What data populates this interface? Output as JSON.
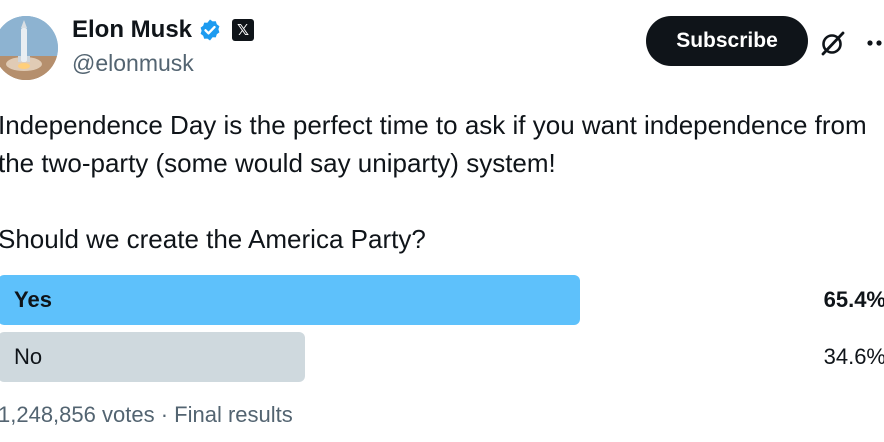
{
  "author": {
    "name": "Elon Musk",
    "handle": "@elonmusk",
    "x_badge": "𝕏"
  },
  "header": {
    "subscribe_label": "Subscribe",
    "icons": [
      "grok-icon",
      "more-icon"
    ]
  },
  "tweet": {
    "text": "Independence Day is the perfect time to ask if you want independence from the two-party (some would say uniparty) system!\n\nShould we create the America Party?"
  },
  "poll": {
    "options": [
      {
        "label": "Yes",
        "percent": "65.4%",
        "share": 0.654,
        "winner": true
      },
      {
        "label": "No",
        "percent": "34.6%",
        "share": 0.346,
        "winner": false
      }
    ],
    "votes": "1,248,856 votes",
    "separator": "·",
    "status": "Final results"
  },
  "colors": {
    "winner_bar": "#5ec1fb",
    "other_bar": "#cfd9de",
    "verified": "#1d9bf0",
    "subscribe_bg": "#0f1419"
  }
}
